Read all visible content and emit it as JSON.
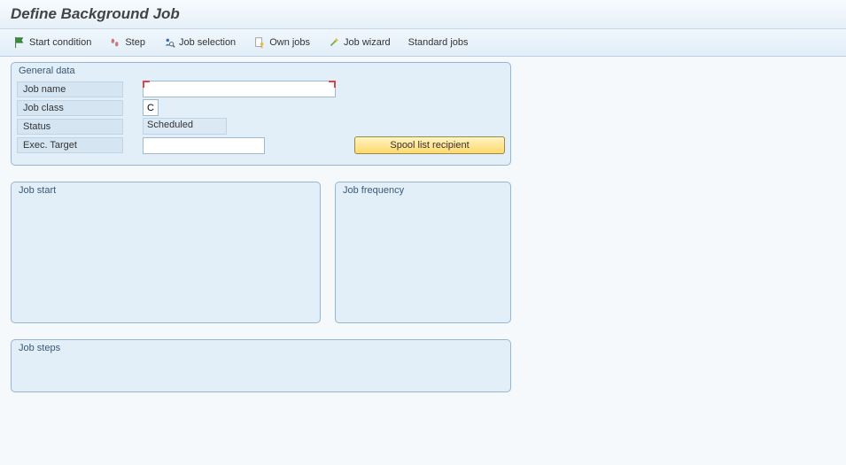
{
  "header": {
    "title": "Define Background Job"
  },
  "toolbar": {
    "start_condition": "Start condition",
    "step": "Step",
    "job_selection": "Job selection",
    "own_jobs": "Own jobs",
    "job_wizard": "Job wizard",
    "standard_jobs": "Standard jobs"
  },
  "general": {
    "legend": "General data",
    "labels": {
      "job_name": "Job name",
      "job_class": "Job class",
      "status": "Status",
      "exec_target": "Exec. Target"
    },
    "values": {
      "job_name": "",
      "job_class": "C",
      "status": "Scheduled",
      "exec_target": ""
    },
    "spool_button": "Spool list recipient"
  },
  "job_start": {
    "legend": "Job start"
  },
  "job_frequency": {
    "legend": "Job frequency"
  },
  "job_steps": {
    "legend": "Job steps"
  }
}
